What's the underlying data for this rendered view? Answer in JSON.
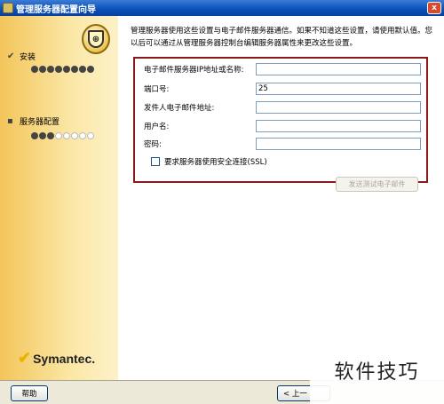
{
  "window": {
    "title": "管理服务器配置向导",
    "close_label": "x"
  },
  "sidebar": {
    "steps": [
      {
        "mark": "✔",
        "label": "安装",
        "progress_filled": 8,
        "progress_total": 8
      },
      {
        "mark": "▪",
        "label": "服务器配置",
        "progress_filled": 3,
        "progress_total": 8
      }
    ],
    "shield_icon": "shield-icon",
    "logo_text": "Symantec."
  },
  "main": {
    "intro": "管理服务器使用这些设置与电子邮件服务器通信。如果不知道这些设置，请使用默认值。您以后可以通过从管理服务器控制台编辑服务器属性来更改这些设置。",
    "fields": [
      {
        "label": "电子邮件服务器IP地址或名称:",
        "value": ""
      },
      {
        "label": "端口号:",
        "value": "25"
      },
      {
        "label": "发件人电子邮件地址:",
        "value": ""
      },
      {
        "label": "用户名:",
        "value": ""
      },
      {
        "label": "密码:",
        "value": ""
      }
    ],
    "ssl_label": "要求服务器使用安全连接(SSL)",
    "ssl_checked": false,
    "send_test_label": "发送测试电子邮件"
  },
  "footer": {
    "help_label": "帮助",
    "back_label": "< 上一"
  },
  "watermark": "软件技巧",
  "colors": {
    "accent_border": "#8a1a1a",
    "title_bar": "#0a4fb8",
    "sidebar": "#f3c55a"
  }
}
